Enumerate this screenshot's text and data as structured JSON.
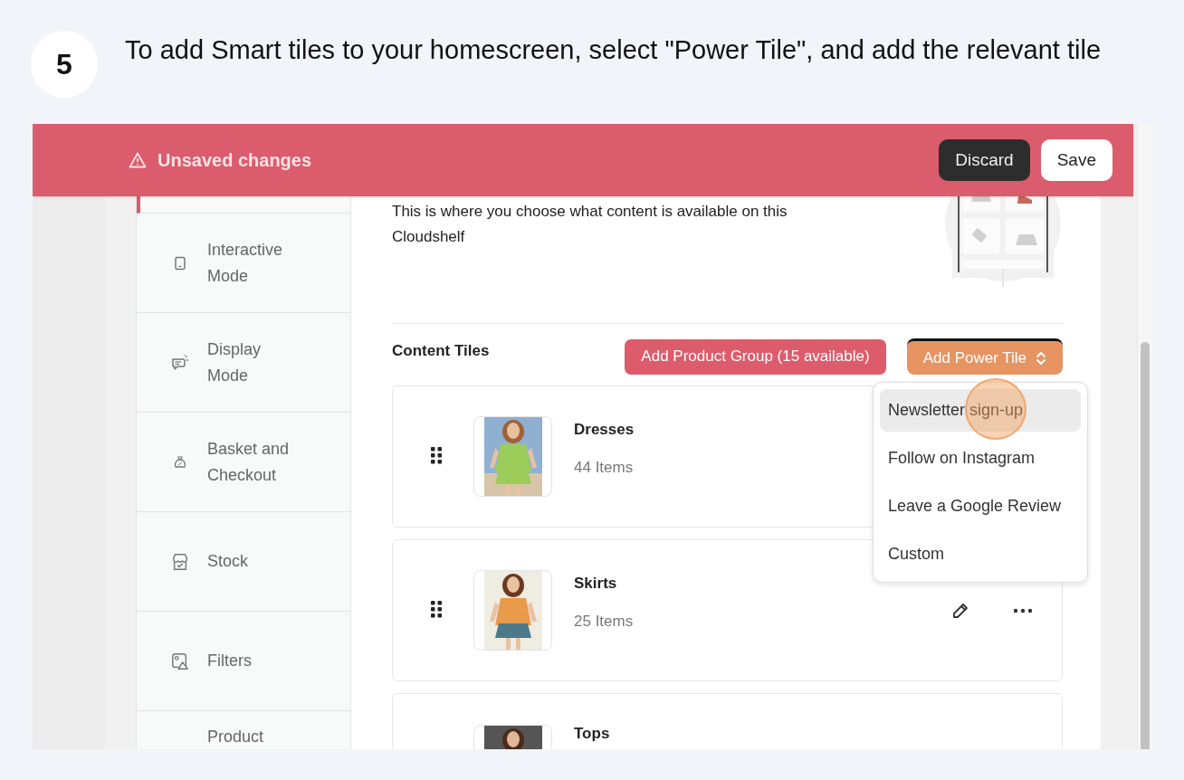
{
  "step": {
    "number": "5",
    "instruction": "To add Smart tiles to your homescreen, select \"Power Tile\", and add the relevant tile"
  },
  "unsaved_bar": {
    "message": "Unsaved changes",
    "buttons": [
      {
        "kind": "dark",
        "label": "Discard"
      },
      {
        "kind": "light",
        "label": "Save"
      }
    ]
  },
  "sidebar": {
    "items": [
      {
        "selected": true
      },
      {
        "label": "Interactive Mode",
        "selected": false
      },
      {
        "label": "Display Mode",
        "selected": false
      },
      {
        "label": "Basket and Checkout",
        "selected": false
      },
      {
        "label": "Stock",
        "selected": false
      },
      {
        "label": "Filters",
        "selected": false
      },
      {
        "label": "Product",
        "selected": false
      }
    ]
  },
  "content": {
    "description": "This is where you choose what content is available on this Cloudshelf",
    "section_title": "Content Tiles",
    "add_group_button": "Add Product Group (15 available)",
    "power_tile_button": {
      "label": "Add Power Tile",
      "expanded": true
    },
    "power_tile_menu": [
      {
        "label": "Newsletter sign-up",
        "selected": true
      },
      {
        "label": "Follow on Instagram",
        "selected": false
      },
      {
        "label": "Leave a Google Review",
        "selected": false
      },
      {
        "label": "Custom",
        "selected": false
      }
    ],
    "tiles": [
      {
        "title": "Dresses",
        "count": "44 Items",
        "actions": false,
        "kind": "picture"
      },
      {
        "title": "Skirts",
        "count": "25 Items",
        "actions": true,
        "kind": "picture"
      },
      {
        "title": "Tops",
        "actions": false,
        "kind": "picture"
      }
    ]
  }
}
